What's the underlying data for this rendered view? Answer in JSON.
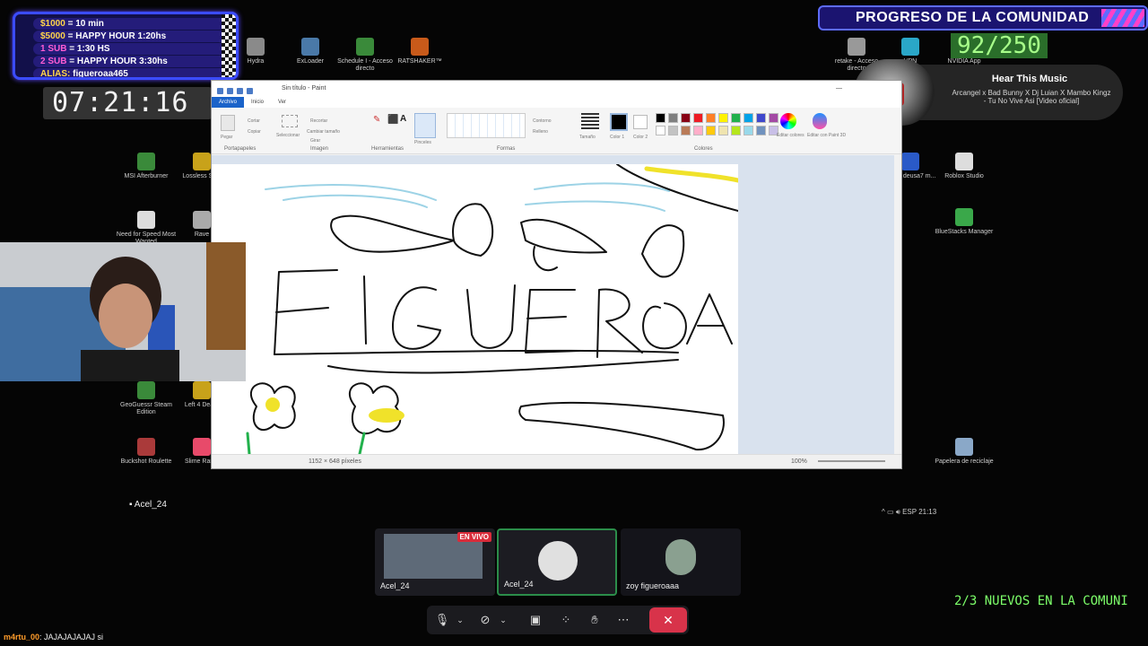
{
  "donations": {
    "rows": [
      {
        "key": "$1000",
        "val": " = 10 min",
        "type": "money"
      },
      {
        "key": "$5000",
        "val": " = HAPPY HOUR 1:20hs",
        "type": "money"
      },
      {
        "key": "1 SUB",
        "val": " = 1:30 HS",
        "type": "sub"
      },
      {
        "key": "2 SUB",
        "val": " = HAPPY HOUR 3:30hs",
        "type": "sub"
      },
      {
        "key": "ALIAS:",
        "val": " figueroaa465",
        "type": "alias"
      }
    ]
  },
  "timer": "07:21:16",
  "progress": {
    "title": "PROGRESO DE LA COMUNIDAD",
    "count": "92/250"
  },
  "music": {
    "heading": "Hear This Music",
    "track": "Arcangel x Bad Bunny X Dj Luian X Mambo Kingz - Tu No Vive Asi [Video oficial]"
  },
  "desktop_icons": [
    {
      "label": "Hydra",
      "color": "#8a8a8a"
    },
    {
      "label": "ExLoader",
      "color": "#4a79a8"
    },
    {
      "label": "Schedule I - Acceso directo",
      "color": "#3a8a3a"
    },
    {
      "label": "RATSHAKER™",
      "color": "#c85a1a"
    },
    {
      "label": "retake - Acceso directo",
      "color": "#999"
    },
    {
      "label": "VPN",
      "color": "#2aa7c8"
    },
    {
      "label": "NVIDIA App",
      "color": "#76b900"
    },
    {
      "label": "MSI Afterburner",
      "color": "#3a8a3a"
    },
    {
      "label": "Lossless Sc...",
      "color": "#c8a21a"
    },
    {
      "label": "Need for Speed Most Wanted",
      "color": "#ddd"
    },
    {
      "label": "Rave",
      "color": "#aaa"
    },
    {
      "label": "Editor deusa7 m...",
      "color": "#2a5ac8"
    },
    {
      "label": "Roblox Studio",
      "color": "#ddd"
    },
    {
      "label": "BlueStacks Manager",
      "color": "#3aa84a"
    },
    {
      "label": "GeoGuessr Steam Edition",
      "color": "#3a8a3a"
    },
    {
      "label": "Left 4 Dea...",
      "color": "#c8a21a"
    },
    {
      "label": "Buckshot Roulette",
      "color": "#aa3a3a"
    },
    {
      "label": "Slime Ran...",
      "color": "#e84a6a"
    },
    {
      "label": "Papelera de reciclaje",
      "color": "#8aa8c8"
    }
  ],
  "paint": {
    "title": "Sin título - Paint",
    "tabs": [
      "Archivo",
      "Inicio",
      "Ver"
    ],
    "groups": [
      "Portapapeles",
      "Imagen",
      "Herramientas",
      "Formas",
      "Colores"
    ],
    "buttons": [
      "Pegar",
      "Cortar",
      "Copiar",
      "Seleccionar",
      "Recortar",
      "Cambiar tamaño",
      "Girar",
      "Pinceles",
      "Contorno",
      "Relleno",
      "Tamaño",
      "Color 1",
      "Color 2",
      "Editar colores",
      "Editar con Paint 3D"
    ],
    "palette": [
      "#000000",
      "#7f7f7f",
      "#880015",
      "#ed1c24",
      "#ff7f27",
      "#fff200",
      "#22b14c",
      "#00a2e8",
      "#3f48cc",
      "#a349a4",
      "#ffffff",
      "#c3c3c3",
      "#b97a57",
      "#ffaec9",
      "#ffc90e",
      "#efe4b0",
      "#b5e61d",
      "#99d9ea",
      "#7092be",
      "#c8bfe7"
    ],
    "status_size": "1152 × 648 píxeles",
    "zoom": "100%",
    "drawing_text": "FIGUEROA"
  },
  "taskbar": {
    "user": "Acel_24",
    "lang": "ESP",
    "time": "21:13"
  },
  "discord": {
    "tiles": [
      {
        "name": "Acel_24",
        "live": "EN VIVO"
      },
      {
        "name": "Acel_24"
      },
      {
        "name": "zoy figueroaaa"
      }
    ]
  },
  "ticker": "2/3 NUEVOS EN LA COMUNI",
  "chat": {
    "user": "m4rtu_00",
    "message": ": JAJAJAJAJAJ si"
  }
}
